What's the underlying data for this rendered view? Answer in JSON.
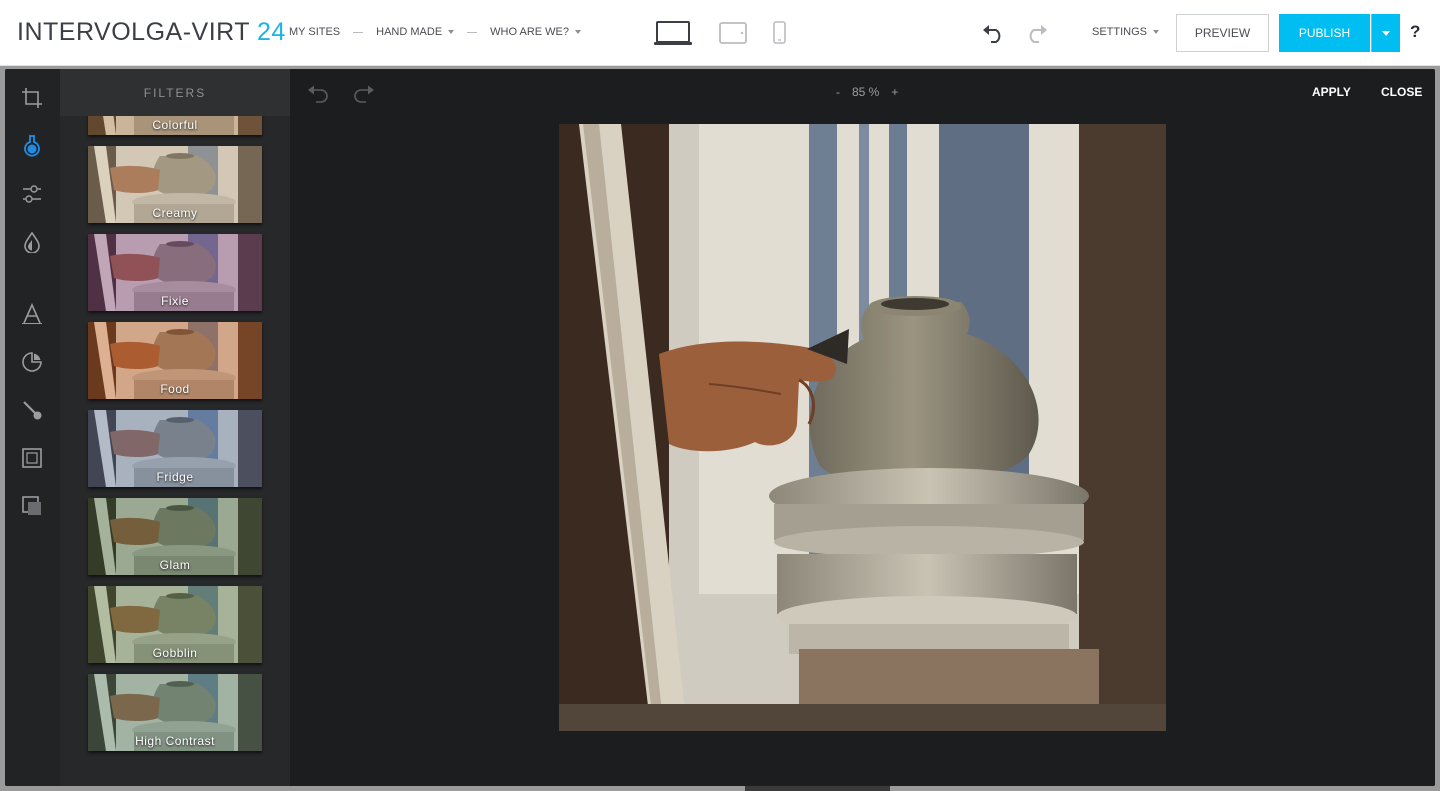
{
  "header": {
    "brand_name": "INTERVOLGA-VIRT",
    "brand_number": "24",
    "nav": [
      {
        "label": "MY SITES"
      },
      {
        "label": "HAND MADE"
      },
      {
        "label": "WHO ARE WE?"
      }
    ],
    "devices": [
      "desktop-icon",
      "tablet-icon",
      "phone-icon"
    ],
    "settings_label": "SETTINGS",
    "preview_label": "PREVIEW",
    "publish_label": "PUBLISH",
    "help_label": "?"
  },
  "editor": {
    "panel_title": "FILTERS",
    "tools": [
      "crop-icon",
      "filter-flask-icon",
      "adjust-sliders-icon",
      "drop-icon",
      "text-icon",
      "sticker-icon",
      "brush-icon",
      "frame-icon",
      "overlay-icon"
    ],
    "active_tool": "filter-flask-icon",
    "filters": [
      {
        "label": "Colorful",
        "tint": "#b3824f"
      },
      {
        "label": "Creamy",
        "tint": "#c9b69a"
      },
      {
        "label": "Fixie",
        "tint": "#7a3d8a"
      },
      {
        "label": "Food",
        "tint": "#c85a1e"
      },
      {
        "label": "Fridge",
        "tint": "#4f78b8"
      },
      {
        "label": "Glam",
        "tint": "#2c5e38"
      },
      {
        "label": "Gobblin",
        "tint": "#4d7a4a"
      },
      {
        "label": "High Contrast",
        "tint": "#3f7c6a"
      }
    ],
    "zoom_minus": "-",
    "zoom_value": "85 %",
    "zoom_plus": "+",
    "apply_label": "APPLY",
    "close_label": "CLOSE"
  },
  "colors": {
    "accent": "#00bef2",
    "brand_number": "#1ab4e6",
    "active_tool": "#1f8de6"
  }
}
